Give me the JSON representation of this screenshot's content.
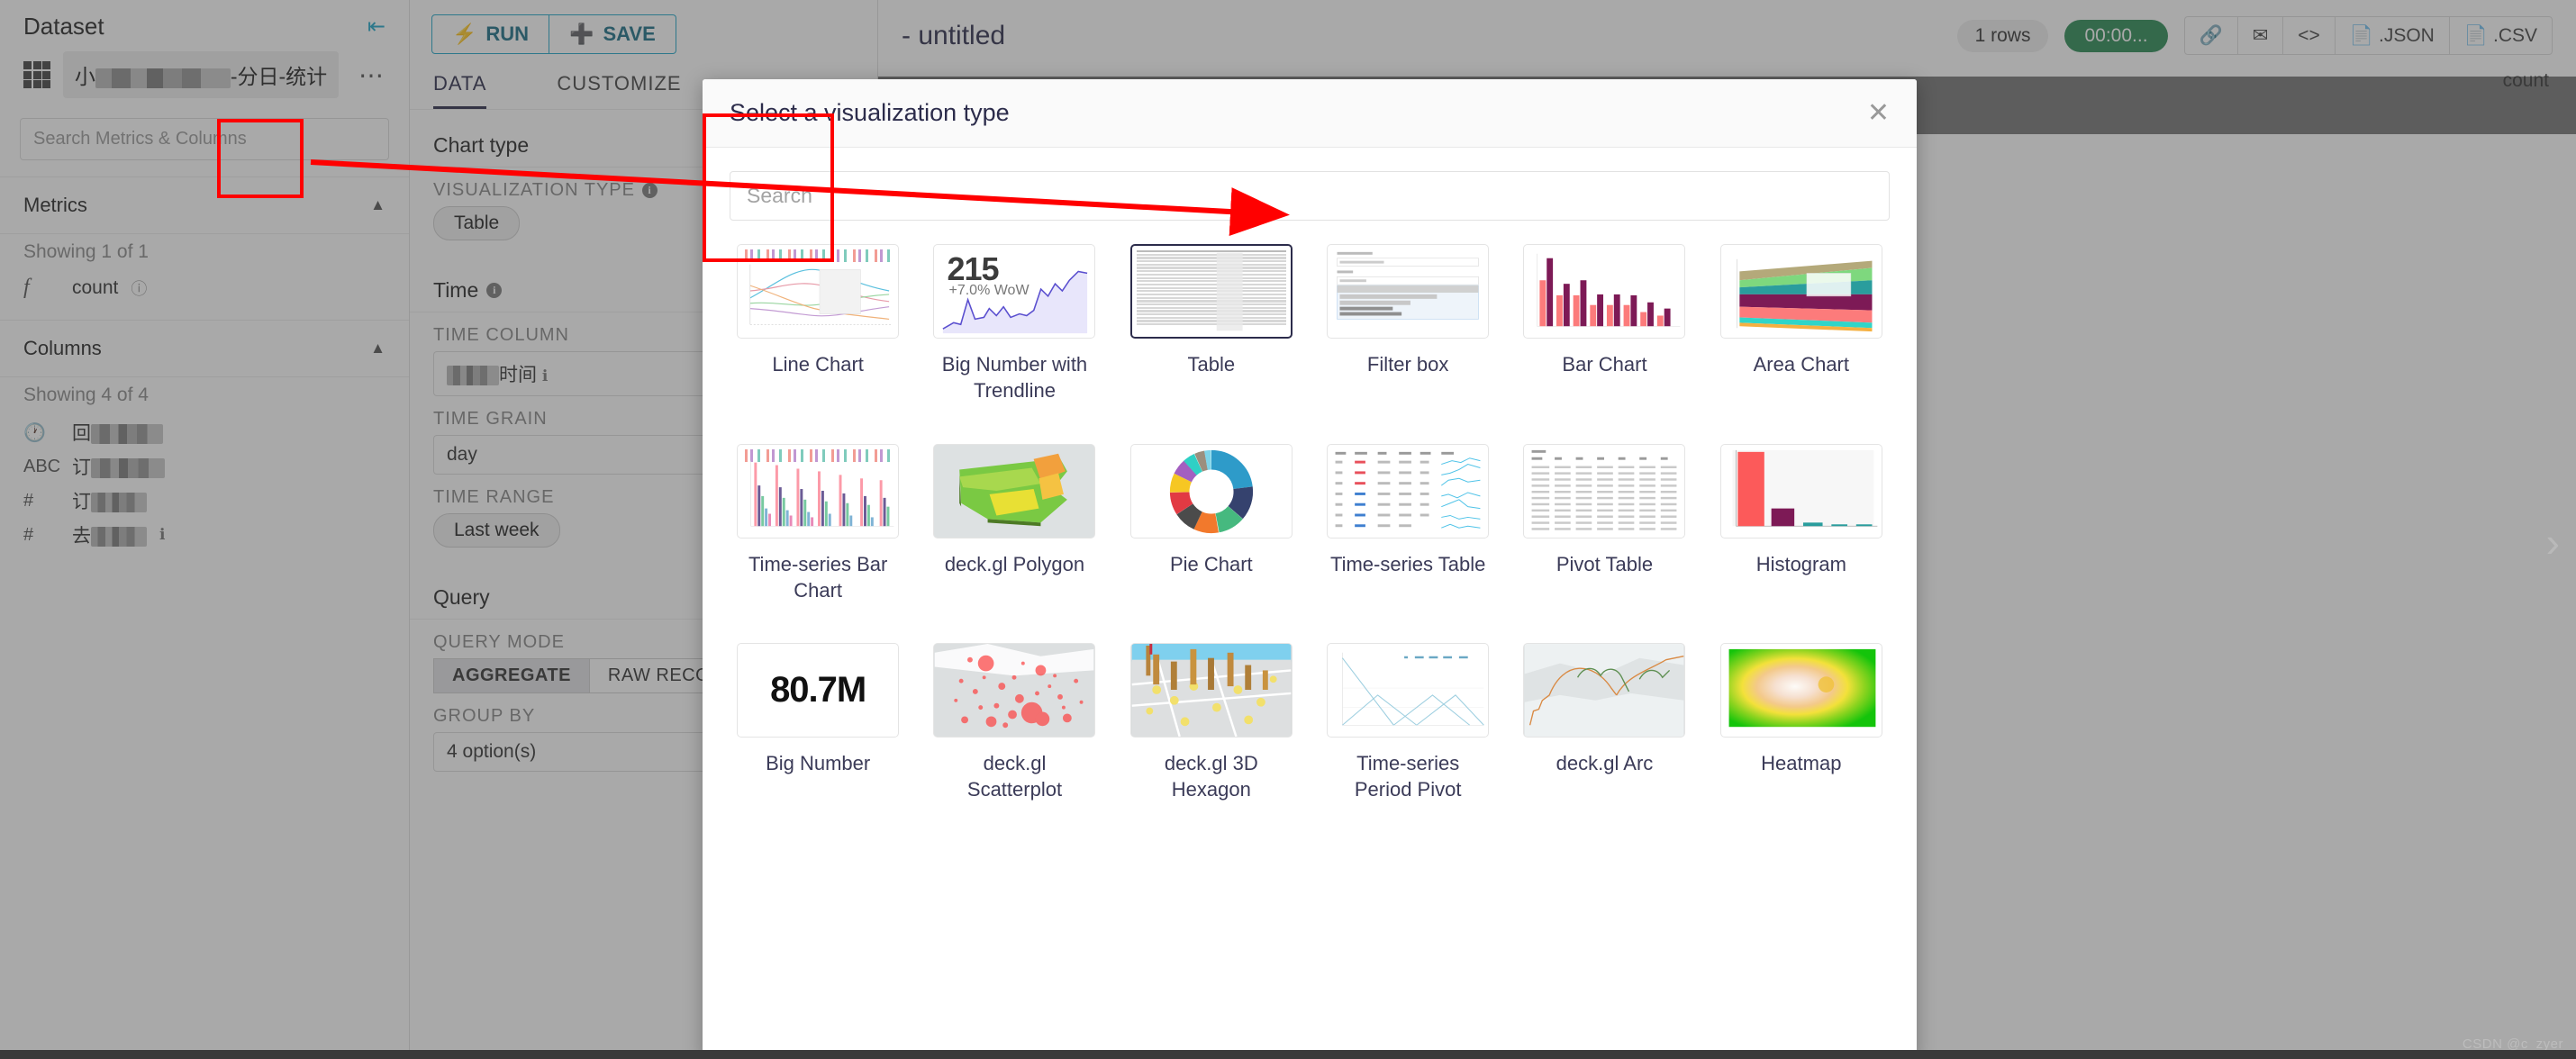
{
  "dataset_panel": {
    "title": "Dataset",
    "collapse_icon": "collapse-panel-icon",
    "dataset_name": "小████-分日-统计",
    "more_icon": "⋯",
    "search_placeholder": "Search Metrics & Columns",
    "metrics": {
      "heading": "Metrics",
      "showing": "Showing 1 of 1",
      "items": [
        {
          "type": "f",
          "label": "count",
          "help": "?"
        }
      ]
    },
    "columns": {
      "heading": "Columns",
      "showing": "Showing 4 of 4",
      "items": [
        {
          "type": "clock",
          "label": "回████"
        },
        {
          "type": "ABC",
          "label": "订████"
        },
        {
          "type": "#",
          "label": "订███"
        },
        {
          "type": "#",
          "label": "去███"
        }
      ]
    }
  },
  "control_panel": {
    "run_label": "RUN",
    "save_label": "SAVE",
    "tabs": [
      {
        "label": "DATA",
        "active": true
      },
      {
        "label": "CUSTOMIZE",
        "active": false
      }
    ],
    "chart_type_group": "Chart type",
    "visualization_type_label": "VISUALIZATION TYPE",
    "visualization_type_value": "Table",
    "time_group": "Time",
    "time_column_label": "TIME COLUMN",
    "time_column_value": "██时间",
    "time_grain_label": "TIME GRAIN",
    "time_grain_value": "day",
    "time_range_label": "TIME RANGE",
    "time_range_value": "Last week",
    "query_group": "Query",
    "query_mode_label": "QUERY MODE",
    "query_mode_options": [
      "AGGREGATE",
      "RAW RECORDS"
    ],
    "query_mode_selected": "AGGREGATE",
    "group_by_label": "GROUP BY",
    "group_by_value": "4 option(s)"
  },
  "main": {
    "chart_title": "- untitled",
    "rows_badge": "1 rows",
    "timer_badge": "00:00...",
    "actions": [
      {
        "icon": "link-icon",
        "label": ""
      },
      {
        "icon": "envelope-icon",
        "label": ""
      },
      {
        "icon": "code-icon",
        "label": ""
      },
      {
        "icon": "json-file-icon",
        "label": ".JSON"
      },
      {
        "icon": "csv-file-icon",
        "label": ".CSV"
      }
    ],
    "result_column_header": "count"
  },
  "modal": {
    "title": "Select a visualization type",
    "close_icon": "close-icon",
    "search_placeholder": "Search",
    "selected": "Table",
    "highlighted": "Filter box",
    "items": [
      {
        "name": "Line Chart",
        "thumb": "line-chart-thumb"
      },
      {
        "name": "Big Number with Trendline",
        "thumb": "big-number-trendline-thumb",
        "value": "215",
        "delta": "+7.0% WoW"
      },
      {
        "name": "Table",
        "thumb": "table-thumb"
      },
      {
        "name": "Filter box",
        "thumb": "filter-box-thumb"
      },
      {
        "name": "Bar Chart",
        "thumb": "bar-chart-thumb"
      },
      {
        "name": "Area Chart",
        "thumb": "area-chart-thumb"
      },
      {
        "name": "Time-series Bar Chart",
        "thumb": "time-series-bar-chart-thumb"
      },
      {
        "name": "deck.gl Polygon",
        "thumb": "deckgl-polygon-thumb"
      },
      {
        "name": "Pie Chart",
        "thumb": "pie-chart-thumb"
      },
      {
        "name": "Time-series Table",
        "thumb": "time-series-table-thumb"
      },
      {
        "name": "Pivot Table",
        "thumb": "pivot-table-thumb"
      },
      {
        "name": "Histogram",
        "thumb": "histogram-thumb"
      },
      {
        "name": "Big Number",
        "thumb": "big-number-thumb",
        "value": "80.7M"
      },
      {
        "name": "deck.gl Scatterplot",
        "thumb": "deckgl-scatterplot-thumb"
      },
      {
        "name": "deck.gl 3D Hexagon",
        "thumb": "deckgl-3d-hexagon-thumb"
      },
      {
        "name": "Time-series Period Pivot",
        "thumb": "time-series-period-pivot-thumb"
      },
      {
        "name": "deck.gl Arc",
        "thumb": "deckgl-arc-thumb"
      },
      {
        "name": "Heatmap",
        "thumb": "heatmap-thumb"
      }
    ]
  },
  "annotations": {
    "color": "#ff0000",
    "boxes": [
      "visualization-type-control",
      "filter-box-card"
    ],
    "arrow": "red-arrow-from-visualization-type-to-filter-box"
  },
  "watermark": "CSDN @c_zyer",
  "next_chevron_icon": "chevron-right-icon"
}
